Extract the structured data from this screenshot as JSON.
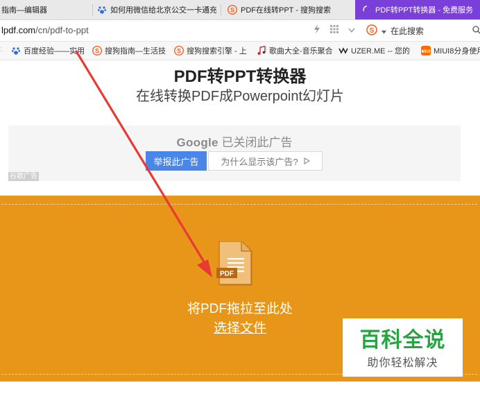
{
  "browser": {
    "tabs": [
      {
        "label": "指南—编辑器",
        "icon": "none"
      },
      {
        "label": "如何用微信给北京公交一卡通充",
        "icon": "baidu-paw-icon"
      },
      {
        "label": "PDF在线转PPT - 搜狗搜索",
        "icon": "sogou-icon"
      },
      {
        "label": "PDF转PPT转换器 - 免费服务",
        "icon": "loading-icon",
        "active": true
      }
    ],
    "close_label": "×",
    "url_host": "lpdf.com",
    "url_path": "/cn/pdf-to-ppt",
    "search_placeholder": "在此搜索",
    "bookmarks": [
      {
        "label": "百度经验——实用",
        "icon": "baidu-paw-icon"
      },
      {
        "label": "搜狗指南—生活技",
        "icon": "sogou-icon"
      },
      {
        "label": "搜狗搜索引擎 - 上",
        "icon": "sogou-icon"
      },
      {
        "label": "歌曲大全-音乐聚合",
        "icon": "music-icon"
      },
      {
        "label": "UZER.ME -- 您的",
        "icon": "uzer-icon"
      },
      {
        "label": "MIUI8分身使用",
        "icon": "miui-icon"
      }
    ]
  },
  "page": {
    "title": "PDF转PPT转换器",
    "subtitle": "在线转换PDF成Powerpoint幻灯片"
  },
  "ad": {
    "google": "Google",
    "closed": "已关闭此广告",
    "report": "举报此广告",
    "why": "为什么显示该广告?",
    "label": "谷歌广告"
  },
  "dropzone": {
    "icon_text": "PDF",
    "text": "将PDF拖拉至此处",
    "choose": "选择文件"
  },
  "watermark": {
    "main": "百科全说",
    "sub": "助你轻松解决"
  },
  "colors": {
    "accent_tab": "#7b3fd9",
    "dropzone": "#e8961a",
    "ad_button": "#4a86e8",
    "watermark_green": "#27a341",
    "arrow_red": "#e83a32"
  }
}
